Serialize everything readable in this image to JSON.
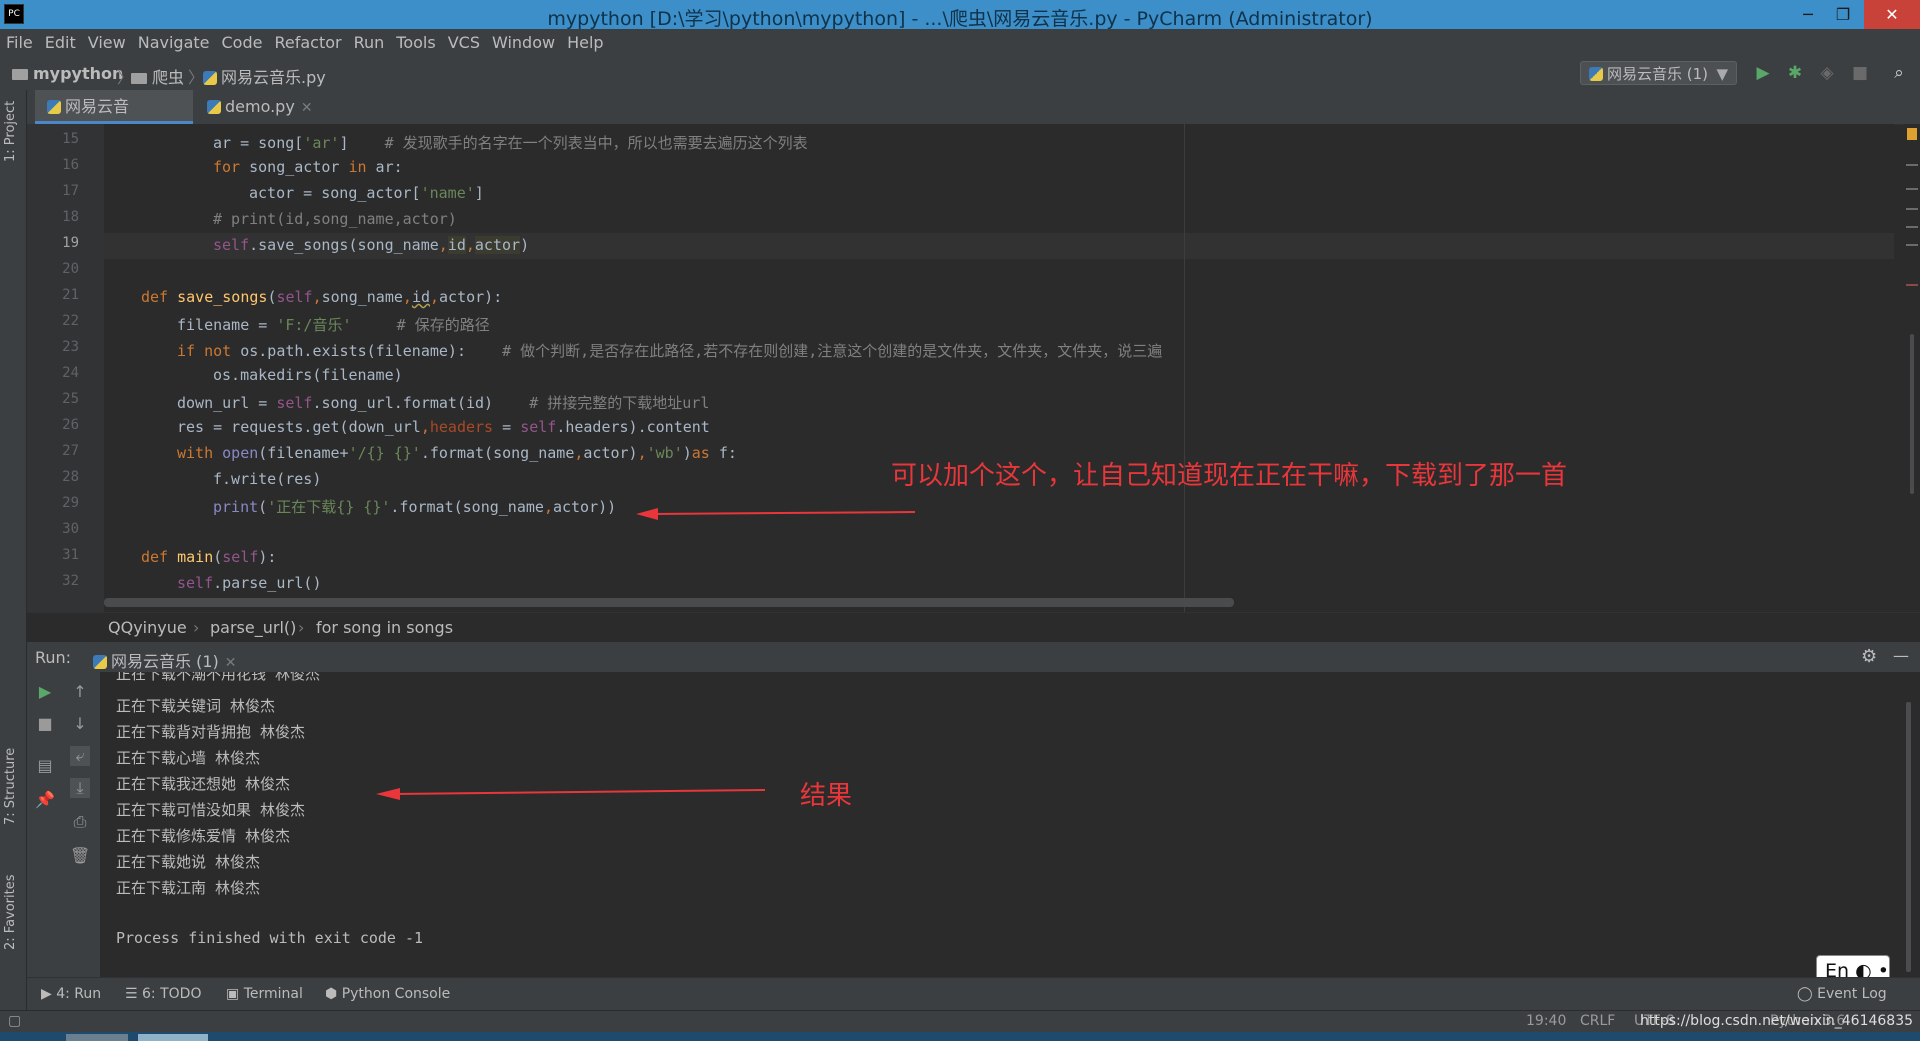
{
  "window": {
    "title": "mypython [D:\\学习\\python\\mypython] - ...\\爬虫\\网易云音乐.py - PyCharm (Administrator)",
    "app_icon": "PC",
    "controls": [
      "─",
      "❐",
      "✕"
    ]
  },
  "menu": [
    "File",
    "Edit",
    "View",
    "Navigate",
    "Code",
    "Refactor",
    "Run",
    "Tools",
    "VCS",
    "Window",
    "Help"
  ],
  "nav": {
    "project": "mypython",
    "folder": "爬虫",
    "file": "网易云音乐.py",
    "run_config": "网易云音乐 (1)"
  },
  "left_tool_tabs": [
    "1: Project",
    "7: Structure",
    "2: Favorites"
  ],
  "editor_tabs": [
    {
      "label": "网易云音乐.py",
      "active": true
    },
    {
      "label": "demo.py",
      "active": false
    }
  ],
  "line_numbers": [
    "15",
    "16",
    "17",
    "18",
    "19",
    "20",
    "21",
    "22",
    "23",
    "24",
    "25",
    "26",
    "27",
    "28",
    "29",
    "30",
    "31",
    "32"
  ],
  "current_line": "19",
  "breadcrumb": [
    "QQyinyue",
    "parse_url()",
    "for song in songs"
  ],
  "run_panel": {
    "label": "Run:",
    "tab": "网易云音乐 (1)",
    "output": [
      "正在下载不潮不用花钱 林俊杰",
      "正在下载关键词 林俊杰",
      "正在下载背对背拥抱 林俊杰",
      "正在下载心墙 林俊杰",
      "正在下载我还想她 林俊杰",
      "正在下载可惜没如果 林俊杰",
      "正在下载修炼爱情 林俊杰",
      "正在下载她说 林俊杰",
      "正在下载江南 林俊杰",
      "",
      "Process finished with exit code -1"
    ]
  },
  "bottom_tabs": [
    "4: Run",
    "6: TODO",
    "Terminal",
    "Python Console"
  ],
  "event_log": "Event Log",
  "status": {
    "position": "19:40",
    "line_sep": "CRLF",
    "encoding": "UTF-8",
    "interpreter": "Python 3.6",
    "watermark": "https://blog.csdn.net/weixin_46146835"
  },
  "ime": "En",
  "annotations": {
    "code_note": "可以加个这个，让自己知道现在正在干嘛，下载到了那一首",
    "result_note": "结果"
  },
  "colors": {
    "titlebar": "#3c8fc8",
    "chrome": "#3c3f41",
    "editor_bg": "#2b2b2b",
    "keyword": "#cc7832",
    "string": "#6a8759",
    "comment": "#808080",
    "annotation": "#e8363b"
  }
}
